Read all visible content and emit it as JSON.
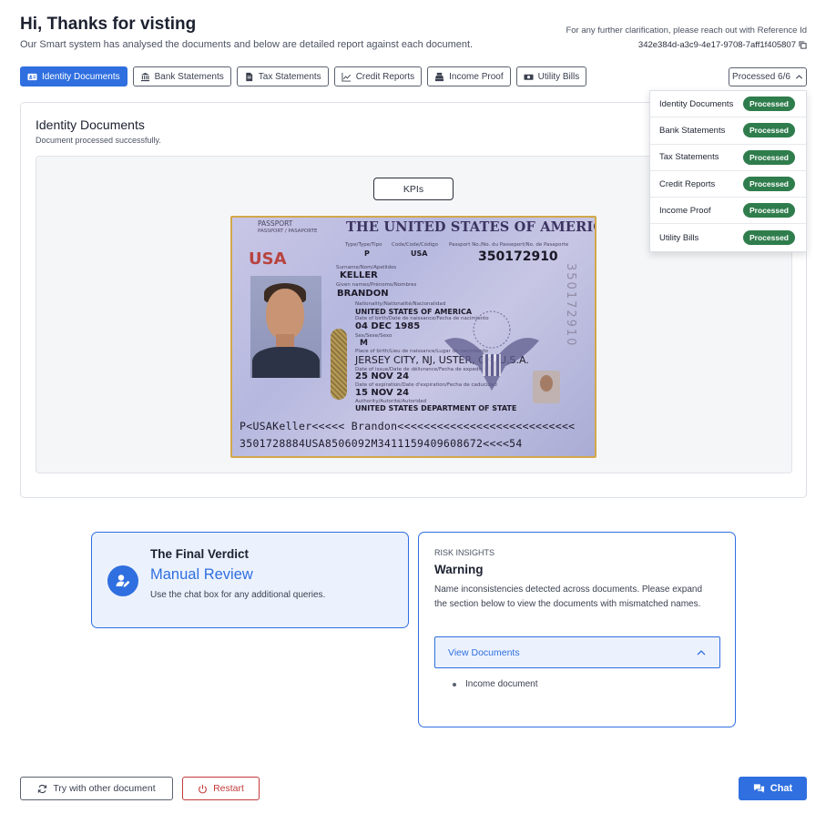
{
  "header": {
    "greeting": "Hi, Thanks for visting",
    "subtitle": "Our Smart system has analysed the documents and below are detailed report against each document.",
    "reference_label": "For any further clarification, please reach out with Reference Id",
    "reference_id": "342e384d-a3c9-4e17-9708-7aff1f405807"
  },
  "tabs": [
    {
      "label": "Identity Documents",
      "icon": "id-card-icon",
      "active": true
    },
    {
      "label": "Bank Statements",
      "icon": "bank-icon",
      "active": false
    },
    {
      "label": "Tax Statements",
      "icon": "document-icon",
      "active": false
    },
    {
      "label": "Credit Reports",
      "icon": "chart-icon",
      "active": false
    },
    {
      "label": "Income Proof",
      "icon": "cash-register-icon",
      "active": false
    },
    {
      "label": "Utility Bills",
      "icon": "money-bill-icon",
      "active": false
    }
  ],
  "processed_button": {
    "label": "Processed 6/6"
  },
  "processed_dropdown": [
    {
      "name": "Identity Documents",
      "status": "Processed"
    },
    {
      "name": "Bank Statements",
      "status": "Processed"
    },
    {
      "name": "Tax Statements",
      "status": "Processed"
    },
    {
      "name": "Credit Reports",
      "status": "Processed"
    },
    {
      "name": "Income Proof",
      "status": "Processed"
    },
    {
      "name": "Utility Bills",
      "status": "Processed"
    }
  ],
  "document_card": {
    "title": "Identity Documents",
    "subtitle": "Document processed successfully.",
    "kpi_button": "KPIs"
  },
  "passport": {
    "header": "THE UNITED STATES OF AMERICA",
    "doc_label": "PASSPORT",
    "doc_label_sub": "PASSPORT / PASAPORTE",
    "country": "USA",
    "type_label": "Type/Type/Tipo",
    "type": "P",
    "code_label": "Code/Code/Código",
    "code": "USA",
    "number_label": "Passport No./No. du Passeport/No. de Pasaporte",
    "number": "350172910",
    "surname_label": "Surname/Nom/Apellidos",
    "surname": "KELLER",
    "given_label": "Given names/Prénoms/Nombres",
    "given_names": "BRANDON",
    "nationality_label": "Nationality/Nationalité/Nacionalidad",
    "nationality": "UNITED STATES OF AMERICA",
    "dob_label": "Date of birth/Date de naissance/Fecha de nacimiento",
    "dob": "04 DEC 1985",
    "sex_label": "Sex/Sexe/Sexo",
    "sex": "M",
    "pob_label": "Place of birth/Lieu de naissance/Lugar de nacimiento",
    "pob": "JERSEY CITY, NJ, USTER, OK, U.S.A.",
    "issue_label": "Date of issue/Date de délivrance/Fecha de expedición",
    "issue_date": "25 NOV 24",
    "expiry_label": "Date of expiration/Date d'expiration/Fecha de caducidad",
    "expiry_date": "15 NOV 24",
    "authority_label": "Authority/Autorité/Autoridad",
    "authority": "UNITED STATES DEPARTMENT OF STATE",
    "mrz_line1": "P<USAKeller<<<<< Brandon<<<<<<<<<<<<<<<<<<<<<<<<<<<",
    "mrz_line2": "3501728884USA8506092M3411159409608672<<<<54",
    "vertical_number": "350172910"
  },
  "verdict": {
    "title": "The Final Verdict",
    "status": "Manual Review",
    "description": "Use the chat box for any additional queries."
  },
  "risk": {
    "label": "RISK INSIGHTS",
    "title": "Warning",
    "description": "Name inconsistencies detected across documents. Please expand the section below to view the documents with mismatched names.",
    "expander_label": "View Documents",
    "items": [
      "Income document"
    ]
  },
  "footer": {
    "try_label": "Try with other document",
    "restart_label": "Restart",
    "chat_label": "Chat"
  },
  "colors": {
    "primary": "#2f6fe0",
    "success": "#2f7d4c",
    "danger": "#c43a3a"
  }
}
